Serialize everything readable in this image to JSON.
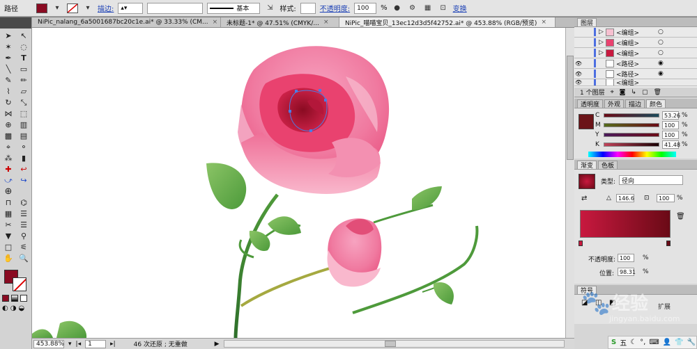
{
  "control_bar": {
    "object_type": "路径",
    "stroke_label": "描边:",
    "stroke_style": "基本",
    "style_label": "样式:",
    "opacity_label": "不透明度:",
    "opacity_value": "100",
    "percent": "%",
    "transform_label": "变换",
    "fill_color": "#8a0b22"
  },
  "tabs": [
    {
      "label": "NiPic_nalang_6a5001687bc20c1e.ai* @ 33.33% (CM..."
    },
    {
      "label": "未标题-1* @ 47.51% (CMYK/..."
    },
    {
      "label": "NiPic_喵喵宝贝_13ec12d3d5f42752.ai* @ 453.88% (RGB/预览)"
    }
  ],
  "tab_close": "×",
  "status": {
    "zoom": "453.88%",
    "page": "1",
    "undo_info": "46 次还原 ; 无重做"
  },
  "layers_panel": {
    "title": "图层",
    "rows": [
      {
        "name": "<编组>"
      },
      {
        "name": "<编组>"
      },
      {
        "name": "<编组>"
      },
      {
        "name": "<路径>"
      },
      {
        "name": "<路径>"
      },
      {
        "name": "<编组>"
      }
    ],
    "footer": "1 个图层"
  },
  "color_panel": {
    "tabs": [
      "透明度",
      "外观",
      "描边",
      "颜色"
    ],
    "channels": [
      {
        "label": "C",
        "value": "53.26",
        "fraction": 0.53
      },
      {
        "label": "M",
        "value": "100",
        "fraction": 1.0
      },
      {
        "label": "Y",
        "value": "100",
        "fraction": 1.0
      },
      {
        "label": "K",
        "value": "41.48",
        "fraction": 0.41
      }
    ],
    "swatch": "#6b1418"
  },
  "gradient_panel": {
    "tabs": [
      "渐变",
      "色板"
    ],
    "type_label": "类型:",
    "type_value": "径向",
    "angle_value": "146.6",
    "ratio_value": "100",
    "opacity_label": "不透明度:",
    "opacity_value": "100",
    "position_label": "位置:",
    "position_value": "98.31",
    "percent": "%",
    "start_color": "#c8193f",
    "end_color": "#6a0a16"
  },
  "extra_panel": {
    "tab": "符号",
    "label": "扩展"
  },
  "watermark": {
    "text": "经验",
    "url": "jingyan.baidu.com"
  },
  "taskbar": {
    "ime": "五"
  }
}
